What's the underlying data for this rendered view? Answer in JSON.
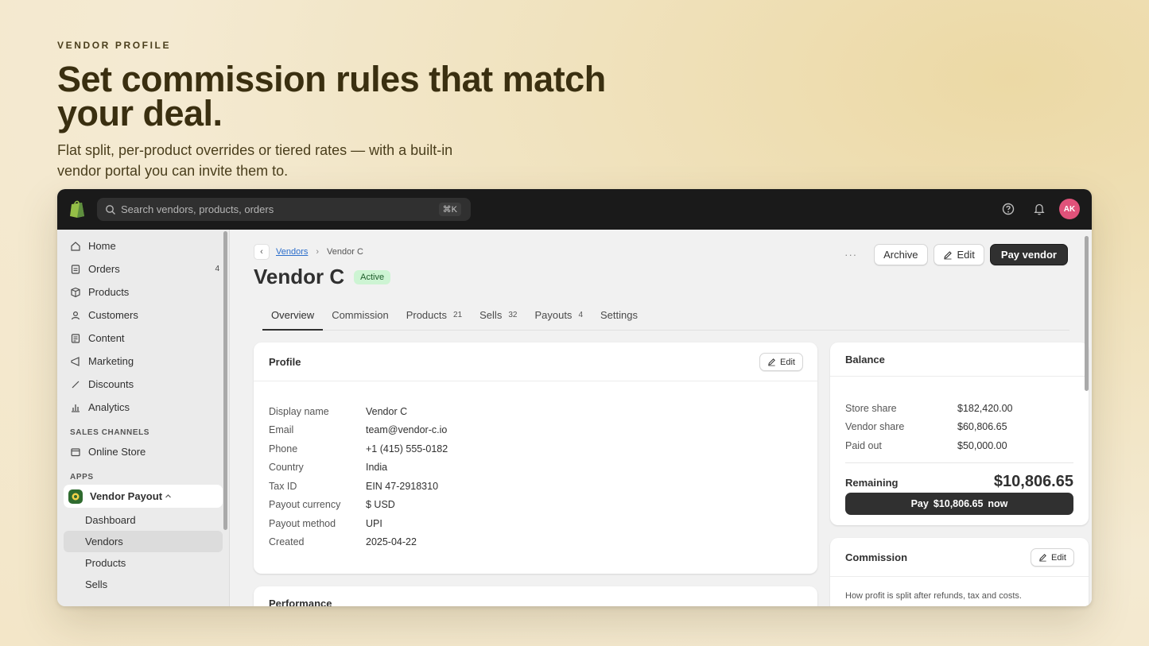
{
  "hero": {
    "eyebrow": "VENDOR PROFILE",
    "headline": "Set commission rules that match your deal.",
    "subtitle": "Flat split, per-product overrides or tiered rates — with a built-in vendor portal you can invite them to."
  },
  "topbar": {
    "search_placeholder": "Search vendors, products, orders",
    "shortcut": "⌘K",
    "avatar_initials": "AK"
  },
  "sidebar": {
    "items": [
      {
        "label": "Home",
        "icon": "home-icon"
      },
      {
        "label": "Orders",
        "icon": "orders-icon",
        "count": "4"
      },
      {
        "label": "Products",
        "icon": "tag-icon"
      },
      {
        "label": "Customers",
        "icon": "person-icon"
      },
      {
        "label": "Content",
        "icon": "content-icon"
      },
      {
        "label": "Marketing",
        "icon": "megaphone-icon"
      },
      {
        "label": "Discounts",
        "icon": "discount-icon"
      },
      {
        "label": "Analytics",
        "icon": "chart-icon"
      }
    ],
    "sales_channels_label": "SALES CHANNELS",
    "online_store": "Online Store",
    "apps_label": "APPS",
    "app_name": "Vendor Payout",
    "app_items": [
      "Dashboard",
      "Vendors",
      "Products",
      "Sells"
    ]
  },
  "breadcrumb": {
    "back": "‹",
    "parent": "Vendors",
    "separator": "›",
    "current": "Vendor C"
  },
  "page": {
    "title": "Vendor C",
    "status": "Active",
    "more": "···",
    "archive": "Archive",
    "edit": "Edit",
    "pay_vendor": "Pay vendor"
  },
  "tabs": [
    {
      "label": "Overview",
      "count": ""
    },
    {
      "label": "Commission",
      "count": ""
    },
    {
      "label": "Products",
      "count": "21"
    },
    {
      "label": "Sells",
      "count": "32"
    },
    {
      "label": "Payouts",
      "count": "4"
    },
    {
      "label": "Settings",
      "count": ""
    }
  ],
  "profile": {
    "title": "Profile",
    "edit": "Edit",
    "rows": [
      {
        "k": "Display name",
        "v": "Vendor C"
      },
      {
        "k": "Email",
        "v": "team@vendor-c.io"
      },
      {
        "k": "Phone",
        "v": "+1 (415) 555-0182"
      },
      {
        "k": "Country",
        "v": "India"
      },
      {
        "k": "Tax ID",
        "v": "EIN 47-2918310"
      },
      {
        "k": "Payout currency",
        "v": "$ USD"
      },
      {
        "k": "Payout method",
        "v": "UPI"
      },
      {
        "k": "Created",
        "v": "2025-04-22"
      }
    ]
  },
  "performance": {
    "title": "Performance"
  },
  "balance": {
    "title": "Balance",
    "rows": [
      {
        "k": "Store share",
        "v": "$182,420.00"
      },
      {
        "k": "Vendor share",
        "v": "$60,806.65"
      },
      {
        "k": "Paid out",
        "v": "$50,000.00"
      }
    ],
    "remaining_label": "Remaining",
    "remaining_value": "$10,806.65",
    "pay_prefix": "Pay",
    "pay_amount": "$10,806.65",
    "pay_suffix": "now"
  },
  "commission": {
    "title": "Commission",
    "edit": "Edit",
    "description": "How profit is split after refunds, tax and costs."
  },
  "colors": {
    "topbar": "#1a1a1a",
    "primary_button": "#303030",
    "active_badge_bg": "#cdf4d3",
    "avatar": "#e0527a",
    "link": "#2c6ecb"
  }
}
